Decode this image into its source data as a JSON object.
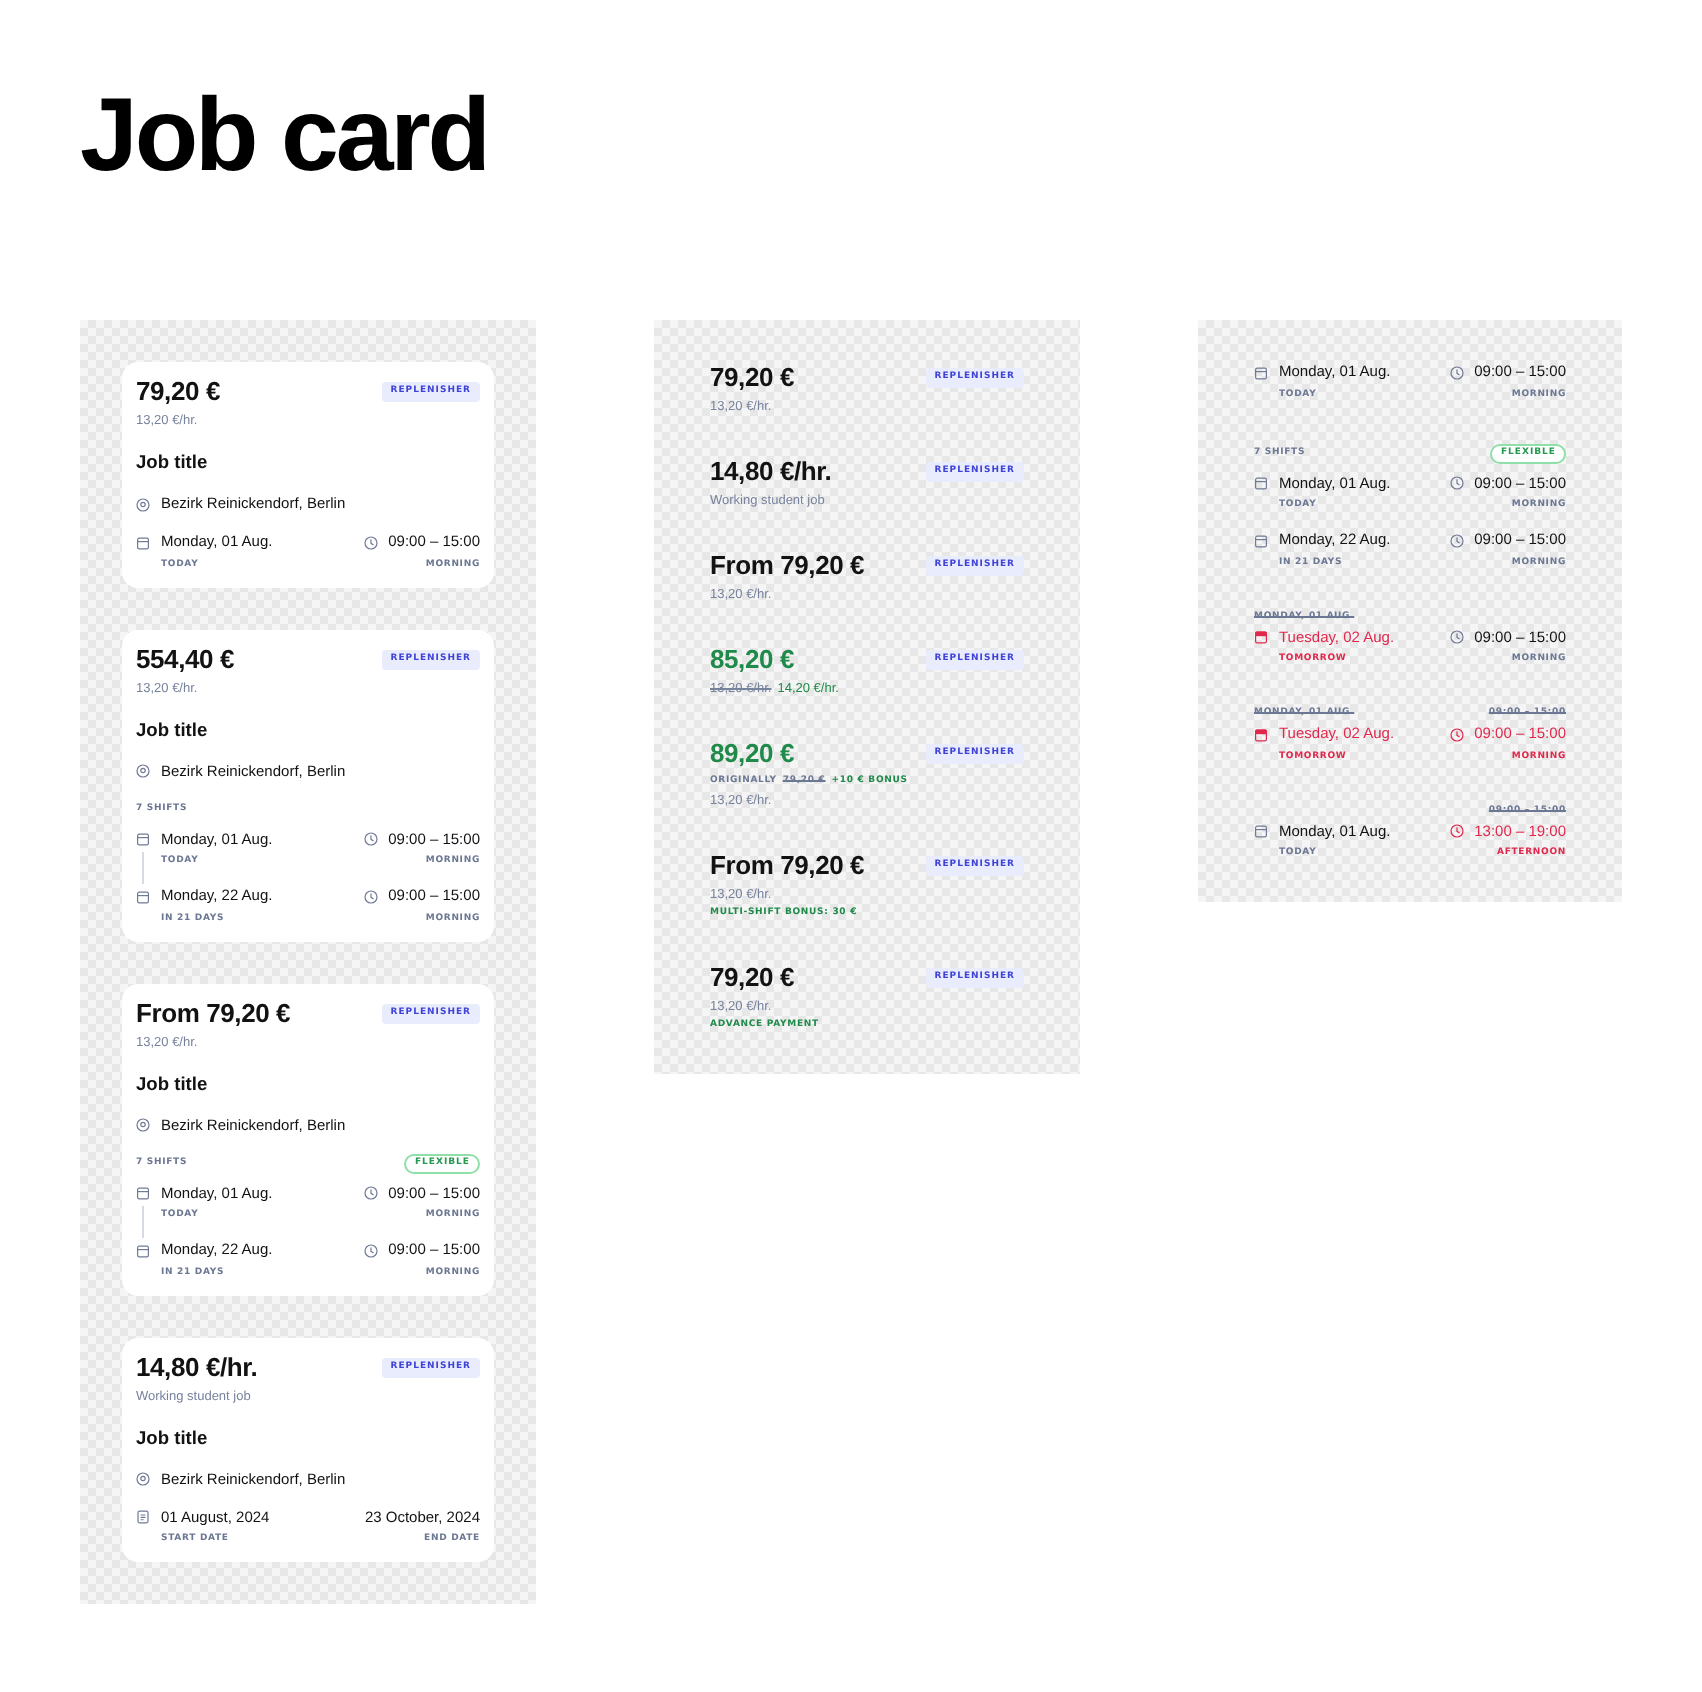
{
  "title": "Job card",
  "cards": [
    {
      "price": {
        "amount": "79,20 €",
        "boosted": false,
        "badge": "REPLENISHER",
        "lines": [
          [
            {
              "kind": "rate",
              "text": "13,20 €/hr.",
              "struck": false
            }
          ]
        ]
      },
      "job_title": "Job title",
      "location": "Bezirk Reinickendorf, Berlin",
      "schedule": {
        "shifts": [
          {
            "kind": "shift",
            "date": {
              "value": "Monday, 01 Aug.",
              "note": "TODAY",
              "changed": false
            },
            "time": {
              "value": "09:00 – 15:00",
              "note": "MORNING",
              "changed": false
            }
          }
        ]
      }
    },
    {
      "price": {
        "amount": "554,40 €",
        "boosted": false,
        "badge": "REPLENISHER",
        "lines": [
          [
            {
              "kind": "rate",
              "text": "13,20 €/hr.",
              "struck": false
            }
          ]
        ]
      },
      "job_title": "Job title",
      "location": "Bezirk Reinickendorf, Berlin",
      "schedule": {
        "label": "7 SHIFTS",
        "connector": true,
        "shifts": [
          {
            "kind": "shift",
            "date": {
              "value": "Monday, 01 Aug.",
              "note": "TODAY",
              "changed": false
            },
            "time": {
              "value": "09:00 – 15:00",
              "note": "MORNING",
              "changed": false
            }
          },
          {
            "kind": "shift",
            "date": {
              "value": "Monday, 22 Aug.",
              "note": "IN 21 DAYS",
              "changed": false
            },
            "time": {
              "value": "09:00 – 15:00",
              "note": "MORNING",
              "changed": false
            }
          }
        ]
      }
    },
    {
      "price": {
        "amount": "From 79,20 €",
        "boosted": false,
        "badge": "REPLENISHER",
        "lines": [
          [
            {
              "kind": "rate",
              "text": "13,20 €/hr.",
              "struck": false
            }
          ]
        ]
      },
      "job_title": "Job title",
      "location": "Bezirk Reinickendorf, Berlin",
      "schedule": {
        "label": "7 SHIFTS",
        "tag": "FLEXIBLE",
        "connector": true,
        "shifts": [
          {
            "kind": "shift",
            "date": {
              "value": "Monday, 01 Aug.",
              "note": "TODAY",
              "changed": false
            },
            "time": {
              "value": "09:00 – 15:00",
              "note": "MORNING",
              "changed": false
            }
          },
          {
            "kind": "shift",
            "date": {
              "value": "Monday, 22 Aug.",
              "note": "IN 21 DAYS",
              "changed": false
            },
            "time": {
              "value": "09:00 – 15:00",
              "note": "MORNING",
              "changed": false
            }
          }
        ]
      }
    },
    {
      "price": {
        "amount": "14,80 €/hr.",
        "boosted": false,
        "badge": "REPLENISHER",
        "lines": [
          [
            {
              "kind": "rate",
              "text": "Working student job",
              "struck": false
            }
          ]
        ]
      },
      "job_title": "Job title",
      "location": "Bezirk Reinickendorf, Berlin",
      "schedule": {
        "shifts": [
          {
            "kind": "period",
            "start": {
              "value": "01 August, 2024",
              "note": "START DATE"
            },
            "end": {
              "value": "23 October, 2024",
              "note": "END DATE"
            }
          }
        ]
      }
    }
  ],
  "price_variants": [
    {
      "amount": "79,20 €",
      "boosted": false,
      "badge": "REPLENISHER",
      "lines": [
        [
          {
            "kind": "rate",
            "text": "13,20 €/hr.",
            "struck": false
          }
        ]
      ]
    },
    {
      "amount": "14,80 €/hr.",
      "boosted": false,
      "badge": "REPLENISHER",
      "lines": [
        [
          {
            "kind": "rate",
            "text": "Working student job",
            "struck": false
          }
        ]
      ]
    },
    {
      "amount": "From 79,20 €",
      "boosted": false,
      "badge": "REPLENISHER",
      "lines": [
        [
          {
            "kind": "rate",
            "text": "13,20 €/hr.",
            "struck": false
          }
        ]
      ]
    },
    {
      "amount": "85,20 €",
      "boosted": true,
      "badge": "REPLENISHER",
      "lines": [
        [
          {
            "kind": "rate",
            "text": "13,20 €/hr.",
            "struck": true
          },
          {
            "kind": "rate-up",
            "text": "14,20 €/hr.",
            "struck": false
          }
        ]
      ]
    },
    {
      "amount": "89,20 €",
      "boosted": true,
      "badge": "REPLENISHER",
      "lines": [
        [
          {
            "kind": "note",
            "text": "ORIGINALLY",
            "struck": false
          },
          {
            "kind": "note",
            "text": "79,20 €",
            "struck": true
          },
          {
            "kind": "note-up",
            "text": "+10 € BONUS",
            "struck": false
          }
        ],
        [
          {
            "kind": "rate",
            "text": "13,20 €/hr.",
            "struck": false
          }
        ]
      ]
    },
    {
      "amount": "From 79,20 €",
      "boosted": false,
      "badge": "REPLENISHER",
      "lines": [
        [
          {
            "kind": "rate",
            "text": "13,20 €/hr.",
            "struck": false
          }
        ],
        [
          {
            "kind": "note-up",
            "text": "MULTI-SHIFT BONUS: 30 €",
            "struck": false
          }
        ]
      ]
    },
    {
      "amount": "79,20 €",
      "boosted": false,
      "badge": "REPLENISHER",
      "lines": [
        [
          {
            "kind": "rate",
            "text": "13,20 €/hr.",
            "struck": false
          }
        ],
        [
          {
            "kind": "note-up",
            "text": "ADVANCE PAYMENT",
            "struck": false
          }
        ]
      ]
    }
  ],
  "schedule_variants": [
    {
      "shifts": [
        {
          "kind": "shift",
          "date": {
            "value": "Monday, 01 Aug.",
            "note": "TODAY",
            "changed": false
          },
          "time": {
            "value": "09:00 – 15:00",
            "note": "MORNING",
            "changed": false
          }
        }
      ]
    },
    {
      "label": "7 SHIFTS",
      "tag": "FLEXIBLE",
      "connector": false,
      "shifts": [
        {
          "kind": "shift",
          "date": {
            "value": "Monday, 01 Aug.",
            "note": "TODAY",
            "changed": false
          },
          "time": {
            "value": "09:00 – 15:00",
            "note": "MORNING",
            "changed": false
          }
        },
        {
          "kind": "shift",
          "date": {
            "value": "Monday, 22 Aug.",
            "note": "IN 21 DAYS",
            "changed": false
          },
          "time": {
            "value": "09:00 – 15:00",
            "note": "MORNING",
            "changed": false
          }
        }
      ]
    },
    {
      "shifts": [
        {
          "kind": "shift",
          "date": {
            "previous": "MONDAY, 01 AUG.",
            "value": "Tuesday, 02 Aug.",
            "note": "TOMORROW",
            "changed": true
          },
          "time": {
            "value": "09:00 – 15:00",
            "note": "MORNING",
            "changed": false
          }
        }
      ]
    },
    {
      "shifts": [
        {
          "kind": "shift",
          "date": {
            "previous": "MONDAY, 01 AUG.",
            "value": "Tuesday, 02 Aug.",
            "note": "TOMORROW",
            "changed": true
          },
          "time": {
            "previous": "09:00 – 15:00",
            "value": "09:00 – 15:00",
            "note": "MORNING",
            "changed": true
          }
        }
      ]
    },
    {
      "shifts": [
        {
          "kind": "shift",
          "date": {
            "value": "Monday, 01 Aug.",
            "note": "TODAY",
            "changed": false
          },
          "time": {
            "previous": "09:00 – 15:00",
            "value": "13:00 – 19:00",
            "note": "AFTERNOON",
            "changed": true
          }
        }
      ]
    }
  ]
}
